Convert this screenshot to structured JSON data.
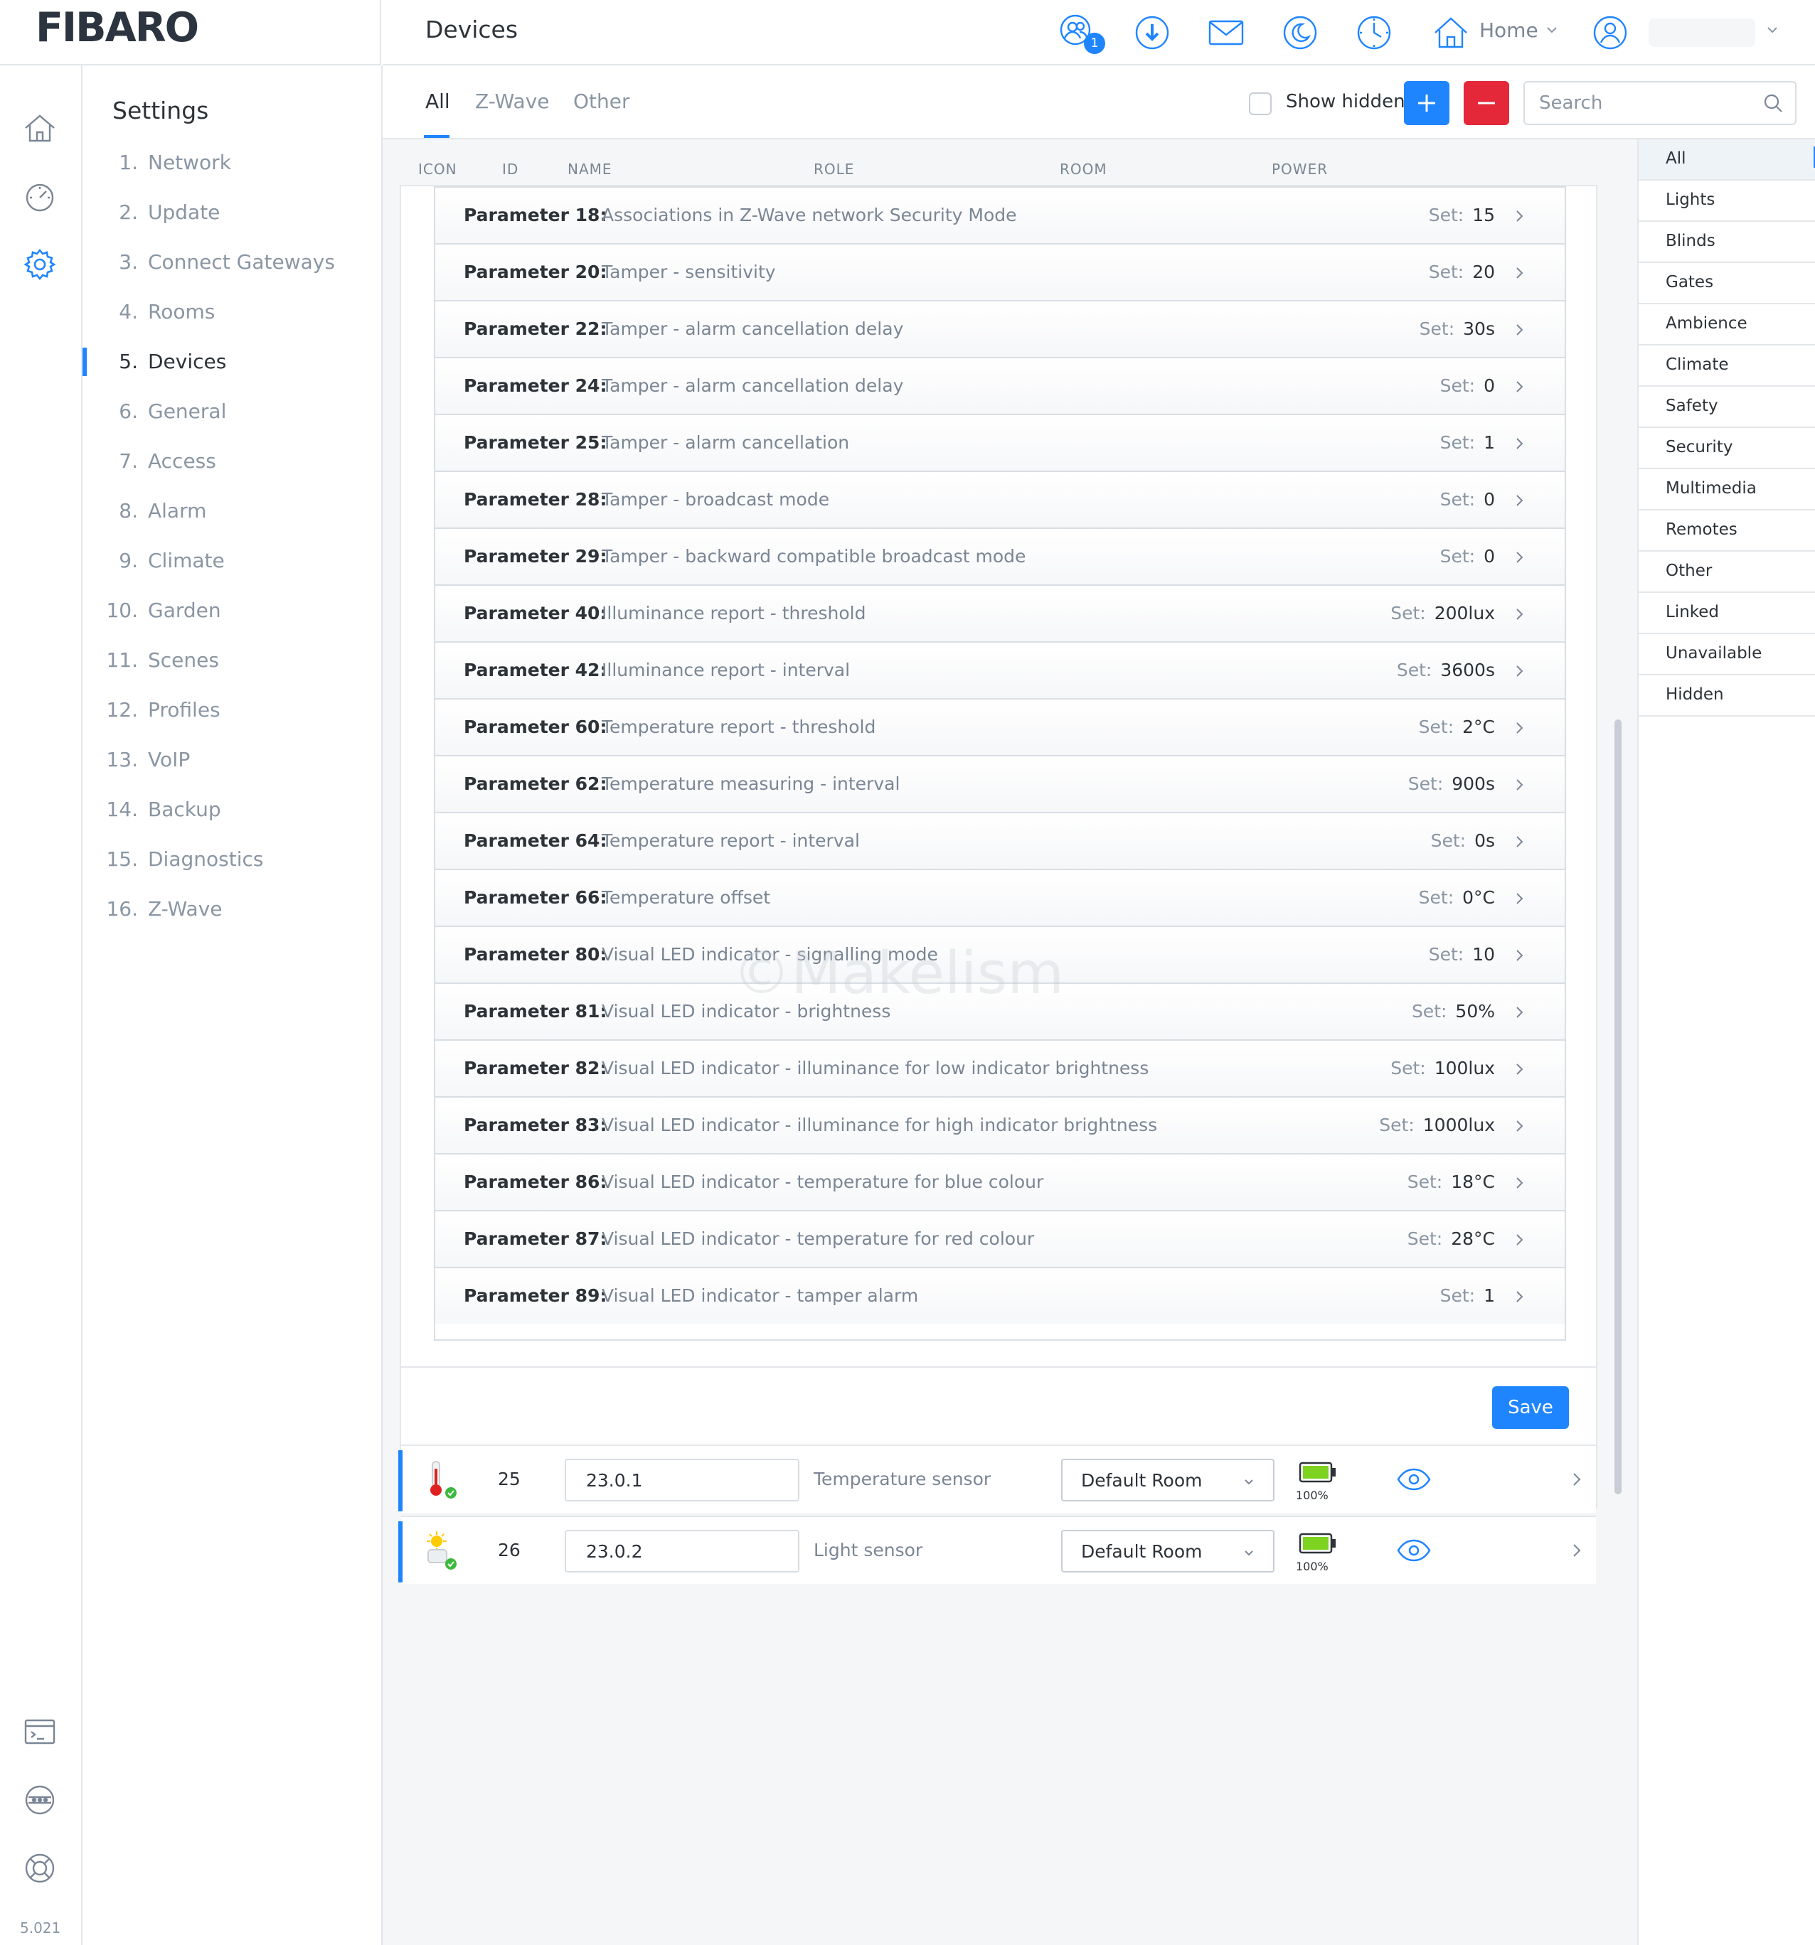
{
  "app": {
    "brand": "FIBARO",
    "page_title": "Devices",
    "version": "5.021",
    "watermark": "©Makelism"
  },
  "topbar": {
    "users_badge": "1",
    "home_label": "Home"
  },
  "settings": {
    "heading": "Settings",
    "items": [
      {
        "num": "1.",
        "label": "Network"
      },
      {
        "num": "2.",
        "label": "Update"
      },
      {
        "num": "3.",
        "label": "Connect Gateways"
      },
      {
        "num": "4.",
        "label": "Rooms"
      },
      {
        "num": "5.",
        "label": "Devices"
      },
      {
        "num": "6.",
        "label": "General"
      },
      {
        "num": "7.",
        "label": "Access"
      },
      {
        "num": "8.",
        "label": "Alarm"
      },
      {
        "num": "9.",
        "label": "Climate"
      },
      {
        "num": "10.",
        "label": "Garden"
      },
      {
        "num": "11.",
        "label": "Scenes"
      },
      {
        "num": "12.",
        "label": "Profiles"
      },
      {
        "num": "13.",
        "label": "VoIP"
      },
      {
        "num": "14.",
        "label": "Backup"
      },
      {
        "num": "15.",
        "label": "Diagnostics"
      },
      {
        "num": "16.",
        "label": "Z-Wave"
      }
    ]
  },
  "toolbar": {
    "tabs": [
      {
        "label": "All"
      },
      {
        "label": "Z-Wave"
      },
      {
        "label": "Other"
      }
    ],
    "show_hidden_label": "Show hidden",
    "search_placeholder": "Search"
  },
  "columns": [
    "ICON",
    "ID",
    "NAME",
    "ROLE",
    "ROOM",
    "POWER"
  ],
  "set_label": "Set:",
  "parameters": [
    {
      "id": "Parameter 18:",
      "name": "Associations in Z-Wave network Security Mode",
      "value": "15"
    },
    {
      "id": "Parameter 20:",
      "name": "Tamper - sensitivity",
      "value": "20"
    },
    {
      "id": "Parameter 22:",
      "name": "Tamper - alarm cancellation delay",
      "value": "30s"
    },
    {
      "id": "Parameter 24:",
      "name": "Tamper - alarm cancellation delay",
      "value": "0"
    },
    {
      "id": "Parameter 25:",
      "name": "Tamper - alarm cancellation",
      "value": "1"
    },
    {
      "id": "Parameter 28:",
      "name": "Tamper - broadcast mode",
      "value": "0"
    },
    {
      "id": "Parameter 29:",
      "name": "Tamper - backward compatible broadcast mode",
      "value": "0"
    },
    {
      "id": "Parameter 40:",
      "name": "Illuminance report - threshold",
      "value": "200lux"
    },
    {
      "id": "Parameter 42:",
      "name": "Illuminance report - interval",
      "value": "3600s"
    },
    {
      "id": "Parameter 60:",
      "name": "Temperature report - threshold",
      "value": "2°C"
    },
    {
      "id": "Parameter 62:",
      "name": "Temperature measuring - interval",
      "value": "900s"
    },
    {
      "id": "Parameter 64:",
      "name": "Temperature report - interval",
      "value": "0s"
    },
    {
      "id": "Parameter 66:",
      "name": "Temperature offset",
      "value": "0°C"
    },
    {
      "id": "Parameter 80:",
      "name": "Visual LED indicator - signalling mode",
      "value": "10"
    },
    {
      "id": "Parameter 81:",
      "name": "Visual LED indicator - brightness",
      "value": "50%"
    },
    {
      "id": "Parameter 82:",
      "name": "Visual LED indicator - illuminance for low indicator brightness",
      "value": "100lux"
    },
    {
      "id": "Parameter 83:",
      "name": "Visual LED indicator - illuminance for high indicator brightness",
      "value": "1000lux"
    },
    {
      "id": "Parameter 86:",
      "name": "Visual LED indicator - temperature for blue colour",
      "value": "18°C"
    },
    {
      "id": "Parameter 87:",
      "name": "Visual LED indicator - temperature for red colour",
      "value": "28°C"
    },
    {
      "id": "Parameter 89:",
      "name": "Visual LED indicator - tamper alarm",
      "value": "1"
    }
  ],
  "save_label": "Save",
  "devices": [
    {
      "id": "25",
      "name": "23.0.1",
      "role": "Temperature sensor",
      "room": "Default Room",
      "battery": "100%",
      "icon": "thermometer-icon"
    },
    {
      "id": "26",
      "name": "23.0.2",
      "role": "Light sensor",
      "room": "Default Room",
      "battery": "100%",
      "icon": "sun-icon"
    }
  ],
  "filters": [
    "All",
    "Lights",
    "Blinds",
    "Gates",
    "Ambience",
    "Climate",
    "Safety",
    "Security",
    "Multimedia",
    "Remotes",
    "Other",
    "Linked",
    "Unavailable",
    "Hidden"
  ],
  "colors": {
    "accent": "#1f85ff",
    "danger": "#e4283a",
    "battery": "#7ed321",
    "ok": "#3cb93c"
  }
}
